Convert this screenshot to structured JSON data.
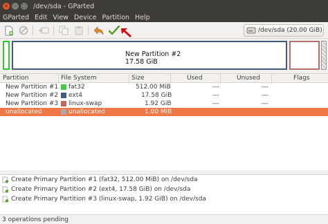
{
  "window": {
    "title": "/dev/sda - GParted"
  },
  "menu": [
    "GParted",
    "Edit",
    "View",
    "Device",
    "Partition",
    "Help"
  ],
  "toolbar": {
    "device": "/dev/sda  (20.00 GiB)"
  },
  "visual": {
    "main_name": "New Partition #2",
    "main_size": "17.58 GiB"
  },
  "table": {
    "headers": [
      "Partition",
      "File System",
      "Size",
      "Used",
      "Unused",
      "Flags"
    ],
    "rows": [
      {
        "partition": "New Partition #1",
        "fs": "fat32",
        "size": "512.00 MiB",
        "used": "---",
        "unused": "---",
        "color": "#3ed03e"
      },
      {
        "partition": "New Partition #2",
        "fs": "ext4",
        "size": "17.58 GiB",
        "used": "---",
        "unused": "---",
        "color": "#3e5c80"
      },
      {
        "partition": "New Partition #3",
        "fs": "linux-swap",
        "size": "1.92 GiB",
        "used": "---",
        "unused": "---",
        "color": "#c1655c"
      },
      {
        "partition": "unallocated",
        "fs": "unallocated",
        "size": "1.00 MiB",
        "used": "---",
        "unused": "---",
        "color": "#a9a9a9"
      }
    ]
  },
  "operations": [
    "Create Primary Partition #1 (fat32, 512.00 MiB) on /dev/sda",
    "Create Primary Partition #2 (ext4, 17.58 GiB) on /dev/sda",
    "Create Primary Partition #3 (linux-swap, 1.92 GiB) on /dev/sda"
  ],
  "status": "3 operations pending",
  "colors": {
    "accent": "#f07746",
    "titlebar": "#3d3c38"
  }
}
